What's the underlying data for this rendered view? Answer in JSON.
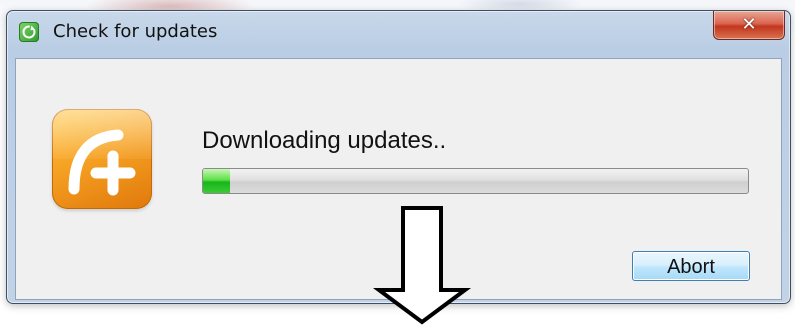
{
  "window": {
    "title": "Check for updates",
    "close_label": "✕"
  },
  "main": {
    "status": "Downloading updates..",
    "progress_fraction": 0.05,
    "abort_label": "Abort"
  },
  "icons": {
    "title": "update-refresh-icon",
    "logo": "app-logo-phone-plus",
    "annotation": "down-arrow-icon"
  },
  "colors": {
    "progress_green": "#27c21f",
    "logo_orange": "#f6a223",
    "close_red": "#c2361e"
  }
}
